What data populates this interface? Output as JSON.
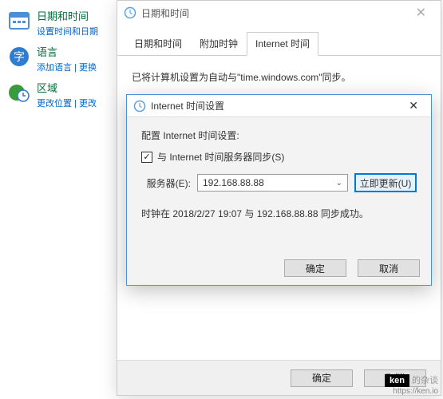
{
  "sidebar": {
    "items": [
      {
        "title": "日期和时间",
        "sub": "设置时间和日期"
      },
      {
        "title": "语言",
        "sub": "添加语言 | 更换"
      },
      {
        "title": "区域",
        "sub": "更改位置 | 更改"
      }
    ]
  },
  "main_dialog": {
    "title": "日期和时间",
    "tabs": [
      "日期和时间",
      "附加时钟",
      "Internet 时间"
    ],
    "active_tab": 2,
    "body_text": "已将计算机设置为自动与\"time.windows.com\"同步。",
    "ok_label": "确定",
    "cancel_label": "取消"
  },
  "inner_dialog": {
    "title": "Internet 时间设置",
    "configure_label": "配置 Internet 时间设置:",
    "checkbox_label": "与 Internet 时间服务器同步(S)",
    "checkbox_checked": true,
    "server_label": "服务器(E):",
    "server_value": "192.168.88.88",
    "update_button": "立即更新(U)",
    "status_text": "时钟在 2018/2/27 19:07 与 192.168.88.88 同步成功。",
    "ok_label": "确定",
    "cancel_label": "取消"
  },
  "watermark": {
    "badge": "ken",
    "text": " 的杂谈",
    "url": "https://ken.io"
  }
}
